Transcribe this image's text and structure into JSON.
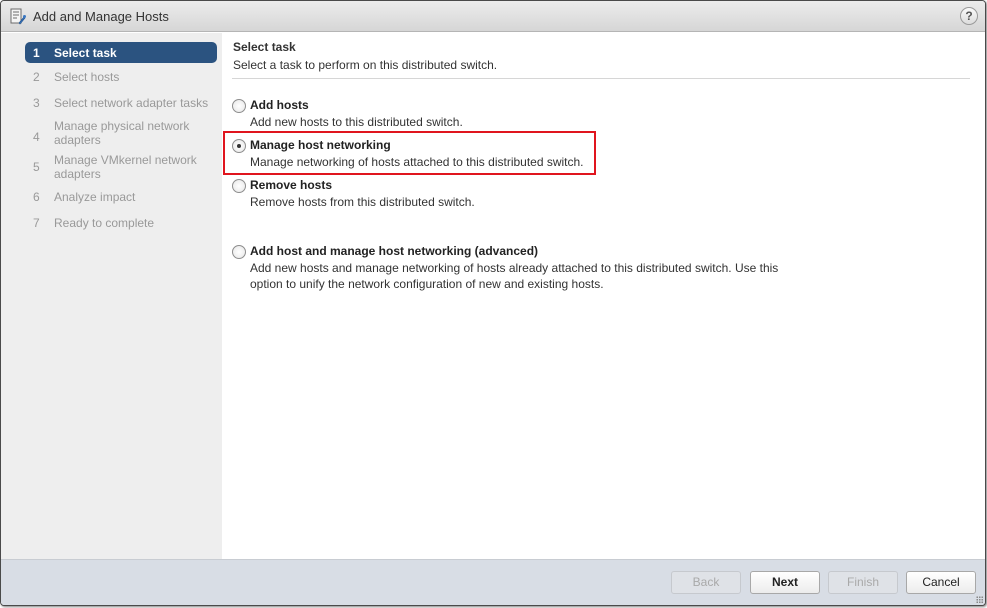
{
  "window": {
    "title": "Add and Manage Hosts",
    "help_label": "?"
  },
  "steps": [
    {
      "num": "1",
      "label": "Select task",
      "state": "active"
    },
    {
      "num": "2",
      "label": "Select hosts",
      "state": "inactive"
    },
    {
      "num": "3",
      "label": "Select network adapter tasks",
      "state": "inactive"
    },
    {
      "num": "4",
      "label": "Manage physical network adapters",
      "state": "inactive"
    },
    {
      "num": "5",
      "label": "Manage VMkernel network adapters",
      "state": "inactive"
    },
    {
      "num": "6",
      "label": "Analyze impact",
      "state": "inactive"
    },
    {
      "num": "7",
      "label": "Ready to complete",
      "state": "inactive"
    }
  ],
  "main": {
    "title": "Select task",
    "subtitle": "Select a task to perform on this distributed switch.",
    "options": [
      {
        "label": "Add hosts",
        "description": "Add new hosts to this distributed switch.",
        "selected": false
      },
      {
        "label": "Manage host networking",
        "description": "Manage networking of hosts attached to this distributed switch.",
        "selected": true
      },
      {
        "label": "Remove hosts",
        "description": "Remove hosts from this distributed switch.",
        "selected": false
      },
      {
        "label": "Add host and manage host networking (advanced)",
        "description": "Add new hosts and manage networking of hosts already attached to this distributed switch. Use this option to unify the network configuration of new and existing hosts.",
        "selected": false
      }
    ]
  },
  "footer": {
    "back_label": "Back",
    "next_label": "Next",
    "finish_label": "Finish",
    "cancel_label": "Cancel"
  },
  "colors": {
    "active_step": "#2b5380",
    "highlight": "#e0151e"
  }
}
